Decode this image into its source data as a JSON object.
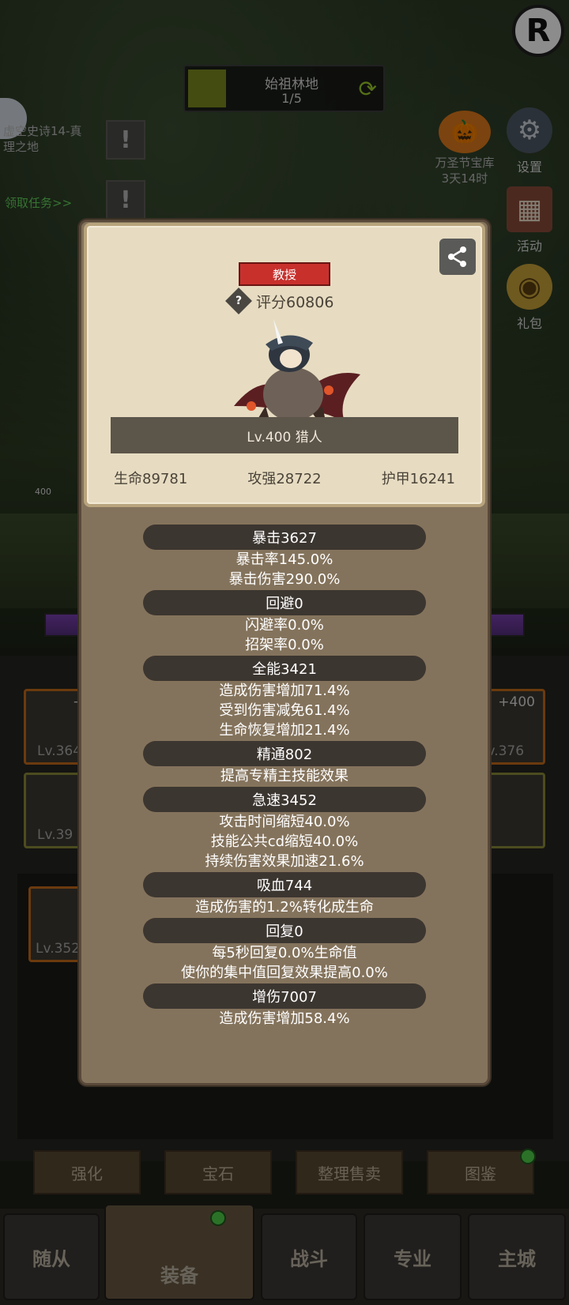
{
  "background": {
    "zone": {
      "name": "始祖林地",
      "progress": "1/5"
    },
    "top_right_logo": "R",
    "quest": {
      "text": "虚空史诗14-真理之地",
      "link": "领取任务>>"
    },
    "event": {
      "name": "万圣节宝库",
      "time": "3天14时"
    },
    "side_buttons": [
      {
        "label": "设置",
        "icon": "gear-icon"
      },
      {
        "label": "活动",
        "icon": "calendar-icon"
      },
      {
        "label": "礼包",
        "icon": "gift-icon"
      }
    ],
    "enemy_level": "400",
    "equip_slots": [
      {
        "level": "Lv.364",
        "plus": "+4"
      },
      {
        "level": "Lv.376",
        "plus": "+400"
      },
      {
        "level": "Lv.39",
        "plus": ""
      },
      {
        "level": "",
        "plus": ""
      },
      {
        "level": "Lv.352",
        "plus": ""
      }
    ],
    "actions": [
      "强化",
      "宝石",
      "整理售卖",
      "图鉴"
    ],
    "nav": [
      "随从",
      "装备",
      "战斗",
      "专业",
      "主城"
    ]
  },
  "card": {
    "title_badge": "教授",
    "score": "评分60806",
    "hero_name": "Lv.400 猎人",
    "stats": {
      "hp": "生命89781",
      "attack": "攻强28722",
      "armor": "护甲16241"
    }
  },
  "stat_groups": [
    {
      "header": "暴击3627",
      "details": [
        "暴击率145.0%",
        "暴击伤害290.0%"
      ]
    },
    {
      "header": "回避0",
      "details": [
        "闪避率0.0%",
        "招架率0.0%"
      ]
    },
    {
      "header": "全能3421",
      "details": [
        "造成伤害增加71.4%",
        "受到伤害减免61.4%",
        "生命恢复增加21.4%"
      ]
    },
    {
      "header": "精通802",
      "details": [
        "提高专精主技能效果"
      ]
    },
    {
      "header": "急速3452",
      "details": [
        "攻击时间缩短40.0%",
        "技能公共cd缩短40.0%",
        "持续伤害效果加速21.6%"
      ]
    },
    {
      "header": "吸血744",
      "details": [
        "造成伤害的1.2%转化成生命"
      ]
    },
    {
      "header": "回复0",
      "details": [
        "每5秒回复0.0%生命值",
        "使你的集中值回复效果提高0.0%"
      ]
    },
    {
      "header": "增伤7007",
      "details": [
        "造成伤害增加58.4%"
      ]
    }
  ]
}
